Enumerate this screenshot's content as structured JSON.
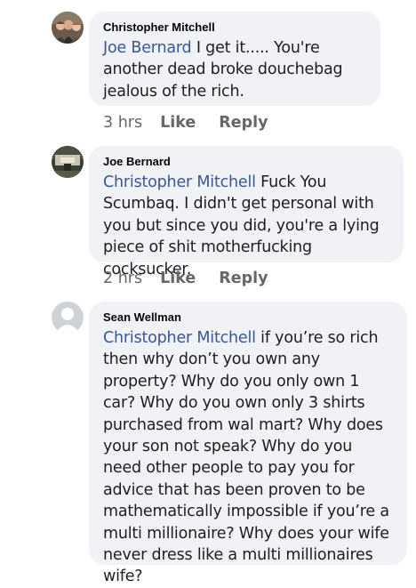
{
  "comments": [
    {
      "author": "Christopher Mitchell",
      "mention": "Joe Bernard",
      "text": " I get it..... You're another dead broke douchebag jealous of the rich.",
      "time": "3 hrs",
      "like_label": "Like",
      "reply_label": "Reply"
    },
    {
      "author": "Joe Bernard",
      "mention": "Christopher Mitchell",
      "text": " Fuck You Scumbaq.  I didn't get personal with you but since you did, you're a lying piece of shit motherfucking cocksucker.",
      "time": "2 hrs",
      "like_label": "Like",
      "reply_label": "Reply"
    },
    {
      "author": "Sean Wellman",
      "mention": "Christopher Mitchell",
      "text": " if you’re so rich then why don’t you own any property? Why do you only own 1 car? Why do you own only 3 shirts purchased from wal mart? Why does your son not speak? Why do you need other people to pay you for advice that has been proven to be mathematically impossible if you’re a multi millionaire? Why does your wife never dress like a multi millionaires wife?"
    }
  ],
  "colors": {
    "bubble": "#f0f2f5",
    "mention": "#385898",
    "meta": "#65676b"
  }
}
